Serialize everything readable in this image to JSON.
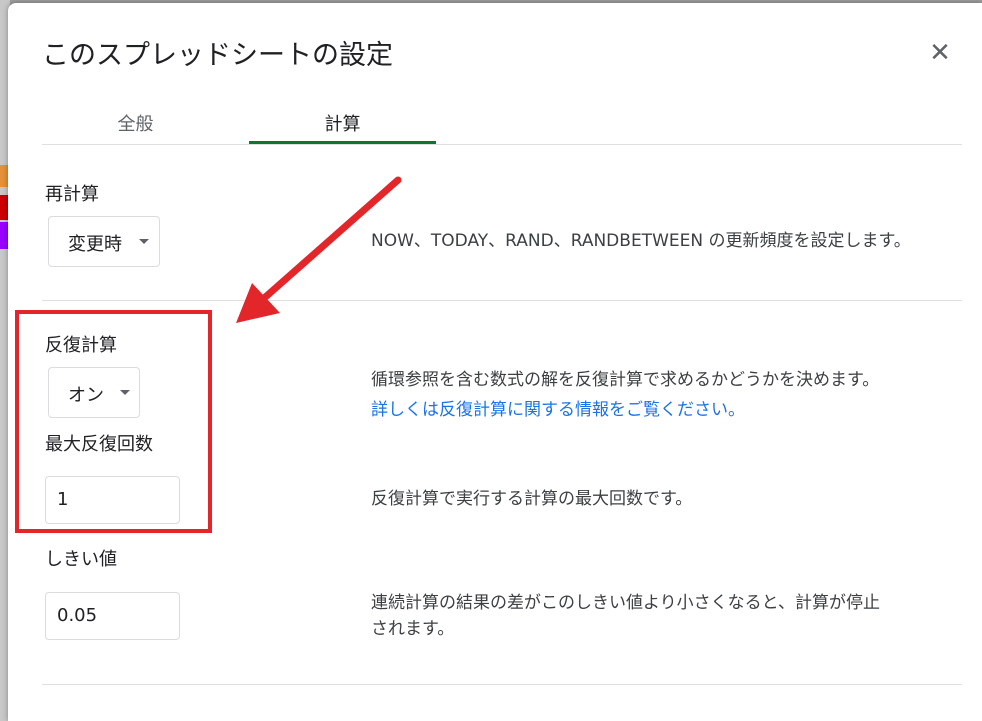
{
  "dialog": {
    "title": "このスプレッドシートの設定",
    "close_icon": "close-icon"
  },
  "tabs": [
    {
      "label": "全般",
      "active": false
    },
    {
      "label": "計算",
      "active": true
    }
  ],
  "recalc": {
    "label": "再計算",
    "selected": "変更時",
    "description": "NOW、TODAY、RAND、RANDBETWEEN の更新頻度を設定します。"
  },
  "iterative": {
    "label": "反復計算",
    "selected": "オン",
    "description": "循環参照を含む数式の解を反復計算で求めるかどうかを決めます。",
    "link": "詳しくは反復計算に関する情報をご覧ください。"
  },
  "max_iterations": {
    "label": "最大反復回数",
    "value": "1",
    "description": "反復計算で実行する計算の最大回数です。"
  },
  "threshold": {
    "label": "しきい値",
    "value": "0.05",
    "description_line1": "連続計算の結果の差がこのしきい値より小さくなると、計算が停止",
    "description_line2": "されます。"
  },
  "colors": {
    "annotation": "#e3262a",
    "active_tab": "#137333",
    "link": "#1a73e8"
  }
}
